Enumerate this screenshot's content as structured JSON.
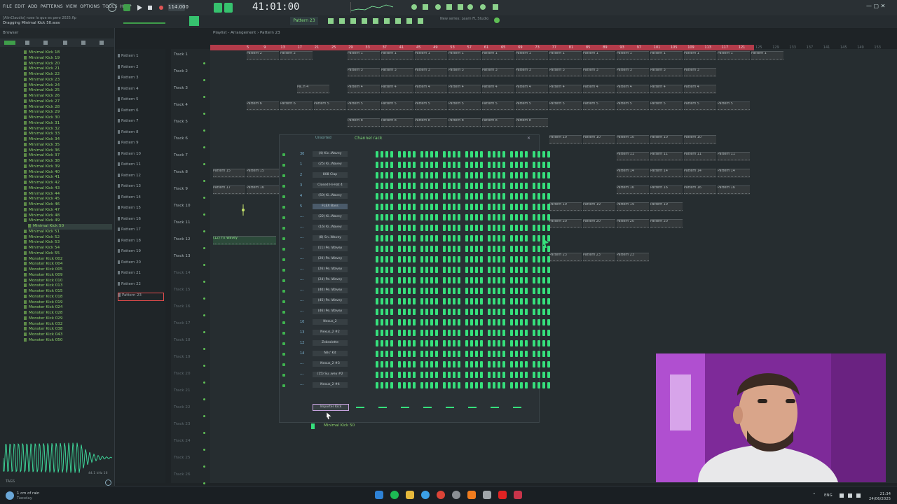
{
  "app": {
    "menu": [
      "FILE",
      "EDIT",
      "ADD",
      "PATTERNS",
      "VIEW",
      "OPTIONS",
      "TOOLS",
      "HELP"
    ],
    "tempo": "114.000",
    "time": "41:01:00",
    "pattern_selector": "Pattern 23",
    "hint_line1": "[AlinClaudio] nose lo que es pero 2025.flp",
    "hint_line2": "Dragging Minimal Kick 50.wav",
    "browser_label": "Browser",
    "playlist_title": "Playlist - Arrangement › Pattern 23",
    "news": "New series: Learn FL Studio"
  },
  "browser": {
    "items": [
      "Minimal Kick 18",
      "Minimal Kick 19",
      "Minimal Kick 20",
      "Minimal Kick 21",
      "Minimal Kick 22",
      "Minimal Kick 23",
      "Minimal Kick 24",
      "Minimal Kick 25",
      "Minimal Kick 26",
      "Minimal Kick 27",
      "Minimal Kick 28",
      "Minimal Kick 29",
      "Minimal Kick 30",
      "Minimal Kick 31",
      "Minimal Kick 32",
      "Minimal Kick 33",
      "Minimal Kick 34",
      "Minimal Kick 35",
      "Minimal Kick 36",
      "Minimal Kick 37",
      "Minimal Kick 38",
      "Minimal Kick 39",
      "Minimal Kick 40",
      "Minimal Kick 41",
      "Minimal Kick 42",
      "Minimal Kick 43",
      "Minimal Kick 44",
      "Minimal Kick 45",
      "Minimal Kick 46",
      "Minimal Kick 47",
      "Minimal Kick 48",
      "Minimal Kick 49",
      "Minimal Kick 50",
      "Minimal Kick 51",
      "Minimal Kick 52",
      "Minimal Kick 53",
      "Minimal Kick 54",
      "Minimal Kick 55",
      "Monster Kick 002",
      "Monster Kick 004",
      "Monster Kick 005",
      "Monster Kick 009",
      "Monster Kick 010",
      "Monster Kick 013",
      "Monster Kick 015",
      "Monster Kick 018",
      "Monster Kick 019",
      "Monster Kick 024",
      "Monster Kick 028",
      "Monster Kick 029",
      "Monster Kick 032",
      "Monster Kick 038",
      "Monster Kick 043",
      "Monster Kick 050"
    ],
    "selected": "Minimal Kick 50",
    "tags_label": "TAGS",
    "sample_info": "44.1 kHz 16"
  },
  "patterns": [
    "Pattern 1",
    "Pattern 2",
    "Pattern 3",
    "Pattern 4",
    "Pattern 5",
    "Pattern 6",
    "Pattern 7",
    "Pattern 8",
    "Pattern 9",
    "Pattern 10",
    "Pattern 11",
    "Pattern 12",
    "Pattern 13",
    "Pattern 14",
    "Pattern 15",
    "Pattern 16",
    "Pattern 17",
    "Pattern 18",
    "Pattern 19",
    "Pattern 20",
    "Pattern 21",
    "Pattern 22",
    "Pattern 23"
  ],
  "tracks": [
    "Track 1",
    "Track 2",
    "Track 3",
    "Track 4",
    "Track 5",
    "Track 6",
    "Track 7",
    "Track 8",
    "Track 9",
    "Track 10",
    "Track 11",
    "Track 12",
    "Track 13",
    "Track 14",
    "Track 15",
    "Track 16",
    "Track 17",
    "Track 18",
    "Track 19",
    "Track 20",
    "Track 21",
    "Track 22",
    "Track 23",
    "Track 24",
    "Track 25",
    "Track 26"
  ],
  "ruler": [
    "5",
    "9",
    "13",
    "17",
    "21",
    "25",
    "29",
    "33",
    "37",
    "41",
    "45",
    "49",
    "53",
    "57",
    "61",
    "65",
    "69",
    "73",
    "77",
    "81",
    "85",
    "89",
    "93",
    "97",
    "101",
    "105",
    "109",
    "113",
    "117",
    "121",
    "125",
    "129",
    "133",
    "137",
    "141",
    "145",
    "149",
    "153"
  ],
  "clips": {
    "track1": [
      "Pattern 2",
      "Pattern 2",
      "Pattern 1",
      "Pattern 1",
      "Pattern 1",
      "Pattern 1",
      "Pattern 1",
      "Pattern 1",
      "Pattern 1",
      "Pattern 1",
      "Pattern 1",
      "Pattern 1",
      "Pattern 1",
      "Pattern 1",
      "Pattern 1"
    ],
    "track2": [
      "Pattern 3",
      "Pattern 3",
      "Pattern 3",
      "Pattern 3",
      "Pattern 3",
      "Pattern 3",
      "Pattern 3",
      "Pattern 3",
      "Pattern 3",
      "Pattern 3",
      "Pattern 3"
    ],
    "track3": [
      "Pa..n 4",
      "Pattern 4",
      "Pattern 4",
      "Pattern 4",
      "Pattern 4",
      "Pattern 4",
      "Pattern 4",
      "Pattern 4",
      "Pattern 4",
      "Pattern 4",
      "Pattern 4",
      "Pattern 4"
    ],
    "track4": [
      "Pattern 6",
      "Pattern 6",
      "Pattern 5",
      "Pattern 5",
      "Pattern 5",
      "Pattern 5",
      "Pattern 5",
      "Pattern 5",
      "Pattern 5",
      "Pattern 5",
      "Pattern 5",
      "Pattern 5",
      "Pattern 5",
      "Pattern 5",
      "Pattern 5"
    ],
    "track5": [
      "Pattern 8",
      "Pattern 8",
      "Pattern 8",
      "Pattern 8",
      "Pattern 8",
      "Pattern 8"
    ],
    "track6": [
      "Pattern 10",
      "Pattern 10",
      "Pattern 10",
      "Pattern 10",
      "Pattern 10"
    ],
    "track7": [
      "Pattern 11",
      "Pattern 11",
      "Pattern 11",
      "Pattern 11"
    ],
    "track8": [
      "Pattern 15",
      "Pattern 15",
      "Pattern 14",
      "Pattern 14",
      "Pattern 14",
      "Pattern 14"
    ],
    "track9": [
      "Pattern 17",
      "Pattern 16",
      "Pattern 16",
      "Pattern 16",
      "Pattern 16",
      "Pattern 16"
    ],
    "track10": [
      "Pattern 19",
      "Pattern 19",
      "Pattern 19",
      "Pattern 19"
    ],
    "track11": [
      "Pattern 20",
      "Pattern 20",
      "Pattern 20",
      "Pattern 20"
    ],
    "track12": [
      "(12) FX Wavey"
    ],
    "track13": [
      "Pattern 23",
      "Pattern 23",
      "Pattern 23"
    ]
  },
  "channel_rack": {
    "title": "Channel rack",
    "filter": "Unsorted",
    "channels": [
      {
        "num": "30",
        "name": "(4) Kic..Wavey"
      },
      {
        "num": "1",
        "name": "(25) Ki..Wavey"
      },
      {
        "num": "2",
        "name": "808 Clap"
      },
      {
        "num": "3",
        "name": "Closed Hi-Hat 4"
      },
      {
        "num": "4",
        "name": "(50) Ki..Wavey"
      },
      {
        "num": "5",
        "name": "FLEX Bass"
      },
      {
        "num": "---",
        "name": "(22) Ki..Wavey"
      },
      {
        "num": "---",
        "name": "(16) Ki..Wavey"
      },
      {
        "num": "---",
        "name": "(8) Sn..Wavey"
      },
      {
        "num": "---",
        "name": "(11) Pe..Wavey"
      },
      {
        "num": "---",
        "name": "(20) Pe..Wavey"
      },
      {
        "num": "---",
        "name": "(26) Pe..Wavey"
      },
      {
        "num": "---",
        "name": "(24) Pe..Wavey"
      },
      {
        "num": "---",
        "name": "(40) Pe..Wavey"
      },
      {
        "num": "---",
        "name": "(45) Pe..Wavey"
      },
      {
        "num": "---",
        "name": "(46) Pe..Wavey"
      },
      {
        "num": "10",
        "name": "Nexus_2"
      },
      {
        "num": "13",
        "name": "Nexus_2 #2"
      },
      {
        "num": "12",
        "name": "Zebralette"
      },
      {
        "num": "14",
        "name": "Nils' Kit"
      },
      {
        "num": "---",
        "name": "Nexus_2 #3"
      },
      {
        "num": "---",
        "name": "(15) Su..wey #2"
      },
      {
        "num": "---",
        "name": "Nexus_2 #4"
      }
    ],
    "new_channel": "Importer Kick",
    "dragged_file": "Minimal Kick 50"
  },
  "taskbar": {
    "weather_temp": "1 cm of rain",
    "weather_day": "Tuesday",
    "lang": "ENG",
    "time": "21:34",
    "date": "24/06/2025"
  },
  "colors": {
    "accent": "#36e07c",
    "ruler": "#b33b4a",
    "browser_text": "#8fd36b",
    "webcam_bg": "#8a2ea4"
  }
}
